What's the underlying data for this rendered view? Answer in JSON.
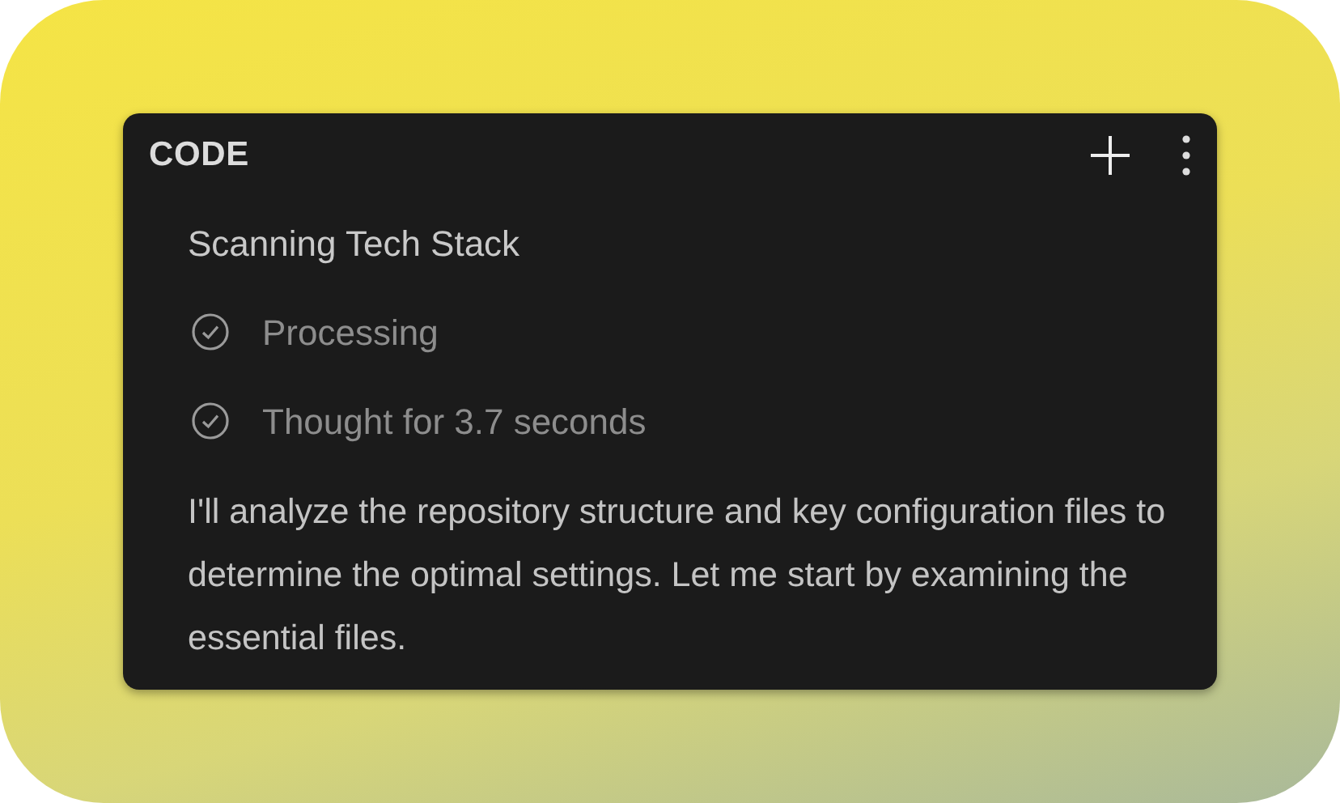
{
  "panel": {
    "title": "CODE"
  },
  "task": {
    "title": "Scanning Tech Stack",
    "steps": [
      {
        "label": "Processing",
        "done": true
      },
      {
        "label": "Thought for 3.7 seconds",
        "done": true
      }
    ],
    "message": "I'll analyze the repository structure and key configuration files to determine the optimal settings. Let me start by examining the essential files."
  }
}
